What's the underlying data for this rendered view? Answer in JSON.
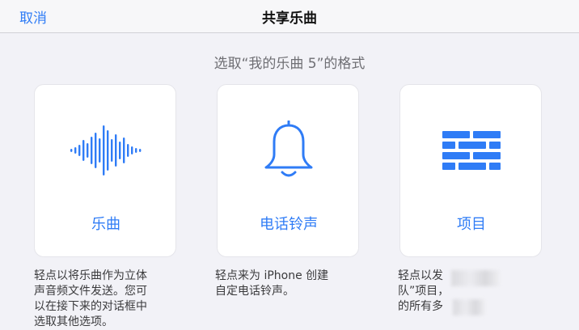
{
  "nav": {
    "cancel_label": "取消",
    "title": "共享乐曲"
  },
  "subtitle": "选取“我的乐曲 5”的格式",
  "options": [
    {
      "label": "乐曲",
      "icon": "waveform-icon",
      "description": "轻点以将乐曲作为立体\n声音频文件发送。您可\n以在接下来的对话框中\n选取其他选项。"
    },
    {
      "label": "电话铃声",
      "icon": "bell-icon",
      "description": "轻点来为 iPhone 创建\n自定电话铃声。"
    },
    {
      "label": "项目",
      "icon": "bricks-icon",
      "description": "轻点以发\n队”项目，\n的所有多"
    }
  ],
  "colors": {
    "accent": "#2f7cf6",
    "background": "#f2f2f7",
    "card": "#ffffff"
  }
}
